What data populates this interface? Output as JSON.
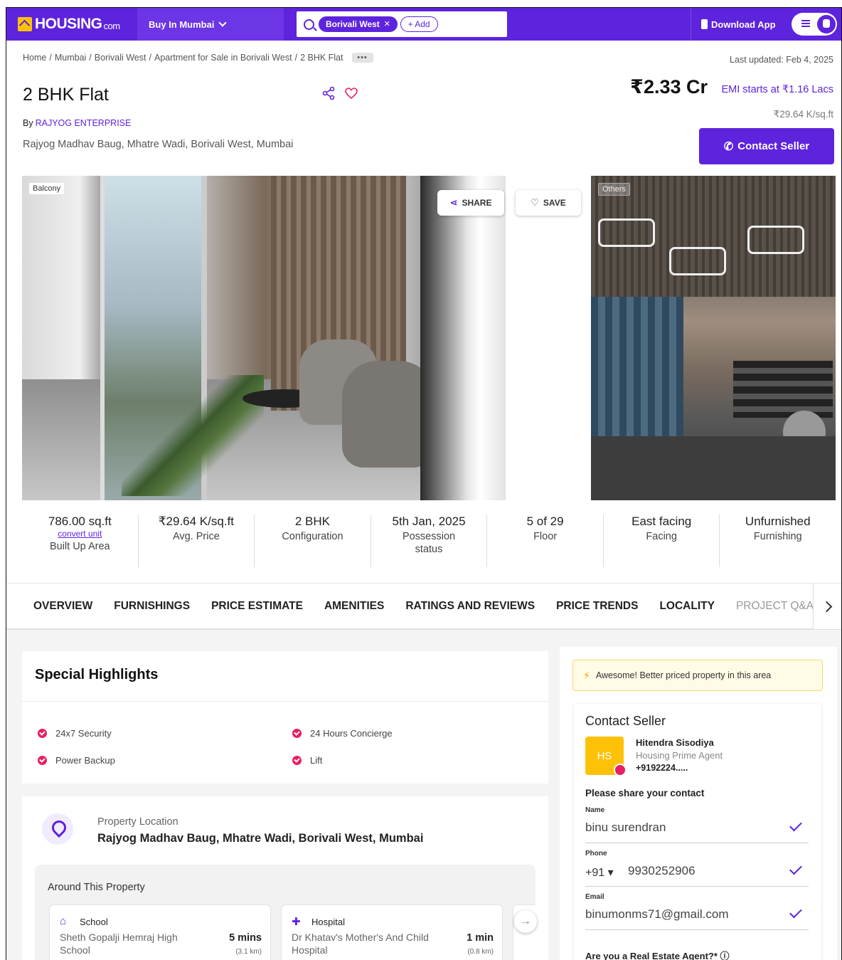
{
  "nav": {
    "logo": "HOUSING",
    "logo_suffix": "com",
    "city_selector": "Buy In Mumbai",
    "search_chip": "Borivali West",
    "add_chip": "+ Add",
    "download_app": "Download App"
  },
  "breadcrumbs": [
    "Home",
    "Mumbai",
    "Borivali West",
    "Apartment for Sale in Borivali West",
    "2 BHK Flat"
  ],
  "breadcrumb_more": "•••",
  "last_updated": "Last updated: Feb 4, 2025",
  "listing": {
    "title": "2 BHK Flat",
    "by_label": "By",
    "seller": "RAJYOG ENTERPRISE",
    "address": "Rajyog Madhav Baug, Mhatre Wadi, Borivali West, Mumbai",
    "price": "₹2.33 Cr",
    "emi": "EMI starts at ₹1.16 Lacs",
    "price_per_sqft": "₹29.64 K/sq.ft",
    "contact_button": "Contact Seller"
  },
  "gallery": {
    "photo1_tag": "Balcony",
    "photo2_tag": "Others",
    "share_button": "SHARE",
    "save_button": "SAVE"
  },
  "specs": [
    {
      "value": "786.00 sq.ft",
      "extra": "convert unit",
      "label": "Built Up Area"
    },
    {
      "value": "₹29.64 K/sq.ft",
      "label": "Avg. Price"
    },
    {
      "value": "2 BHK",
      "label": "Configuration"
    },
    {
      "value": "5th Jan, 2025",
      "label": "Possession status"
    },
    {
      "value": "5 of 29",
      "label": "Floor"
    },
    {
      "value": "East facing",
      "label": "Facing"
    },
    {
      "value": "Unfurnished",
      "label": "Furnishing"
    }
  ],
  "tabs": [
    "OVERVIEW",
    "FURNISHINGS",
    "PRICE ESTIMATE",
    "AMENITIES",
    "RATINGS AND REVIEWS",
    "PRICE TRENDS",
    "LOCALITY",
    "PROJECT Q&A"
  ],
  "highlights": {
    "title": "Special Highlights",
    "items": [
      "24x7 Security",
      "24 Hours Concierge",
      "Power Backup",
      "Lift"
    ]
  },
  "location": {
    "label": "Property Location",
    "address": "Rajyog Madhav Baug, Mhatre Wadi, Borivali West, Mumbai",
    "around_title": "Around This Property",
    "pois": [
      {
        "type": "School",
        "name": "Sheth Gopalji Hemraj High School",
        "time": "5 mins",
        "dist": "(3.1 km)"
      },
      {
        "type": "Hospital",
        "name": "Dr Khatav's Mother's And Child Hospital",
        "time": "1 min",
        "dist": "(0.8 km)"
      }
    ]
  },
  "contact": {
    "promo": "Awesome! Better priced property in this area",
    "title": "Contact Seller",
    "initials": "HS",
    "agent_name": "Hitendra Sisodiya",
    "agent_role": "Housing Prime Agent",
    "agent_phone": "+9192224.....",
    "share_prompt": "Please share your contact",
    "name_label": "Name",
    "name_value": "binu surendran",
    "phone_label": "Phone",
    "country_code": "+91 ▾",
    "phone_value": "9930252906",
    "email_label": "Email",
    "email_value": "binumonms71@gmail.com",
    "agent_question": "Are you a Real Estate Agent?* ⓘ"
  },
  "colors": {
    "brand": "#5e23dc",
    "accent_pink": "#e91e63",
    "logo_yellow": "#ffc107"
  }
}
